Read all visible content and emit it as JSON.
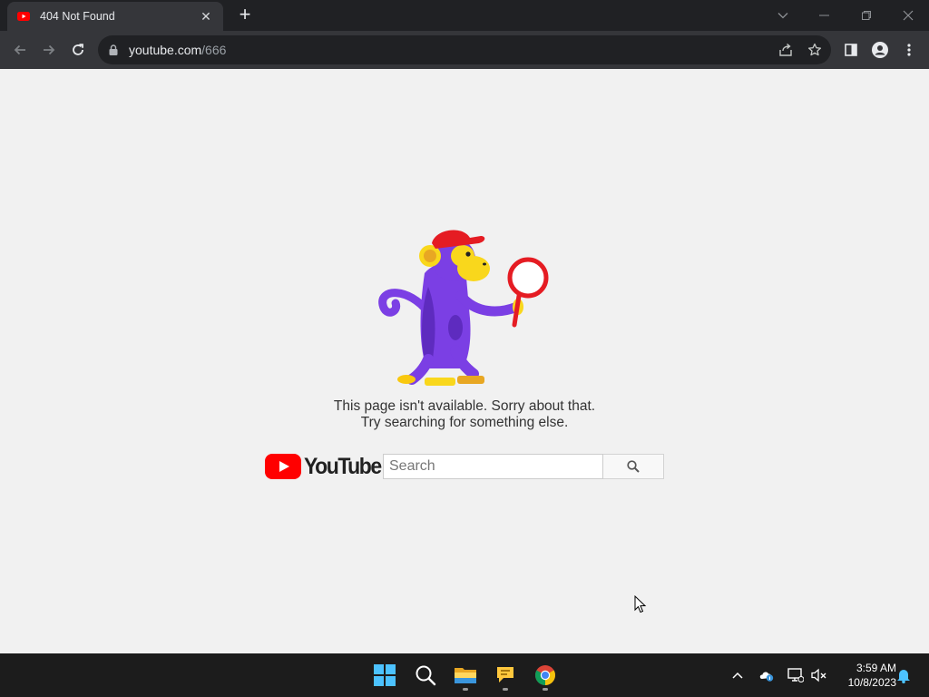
{
  "browser": {
    "tab": {
      "title": "404 Not Found",
      "favicon": "youtube-favicon-icon"
    },
    "url": {
      "host": "youtube.com",
      "path": "/666"
    },
    "icons": [
      "back-icon",
      "forward-icon",
      "reload-icon",
      "lock-icon",
      "share-icon",
      "star-icon",
      "side-panel-icon",
      "profile-icon",
      "menu-icon"
    ]
  },
  "page": {
    "message_line1": "This page isn't available. Sorry about that.",
    "message_line2": "Try searching for something else.",
    "logo_text": "YouTube",
    "search": {
      "placeholder": "Search",
      "value": ""
    },
    "colors": {
      "brand": "#ff0000",
      "monkey": "#7b3fe4",
      "accent": "#f9d71c"
    }
  },
  "taskbar": {
    "apps": [
      "windows-start-icon",
      "search-icon",
      "file-explorer-icon",
      "feedback-icon",
      "chrome-icon"
    ],
    "tray": [
      "chevron-up-icon",
      "onedrive-icon",
      "network-icon",
      "volume-muted-icon",
      "notification-bell-icon"
    ],
    "time": "3:59 AM",
    "date": "10/8/2023"
  }
}
